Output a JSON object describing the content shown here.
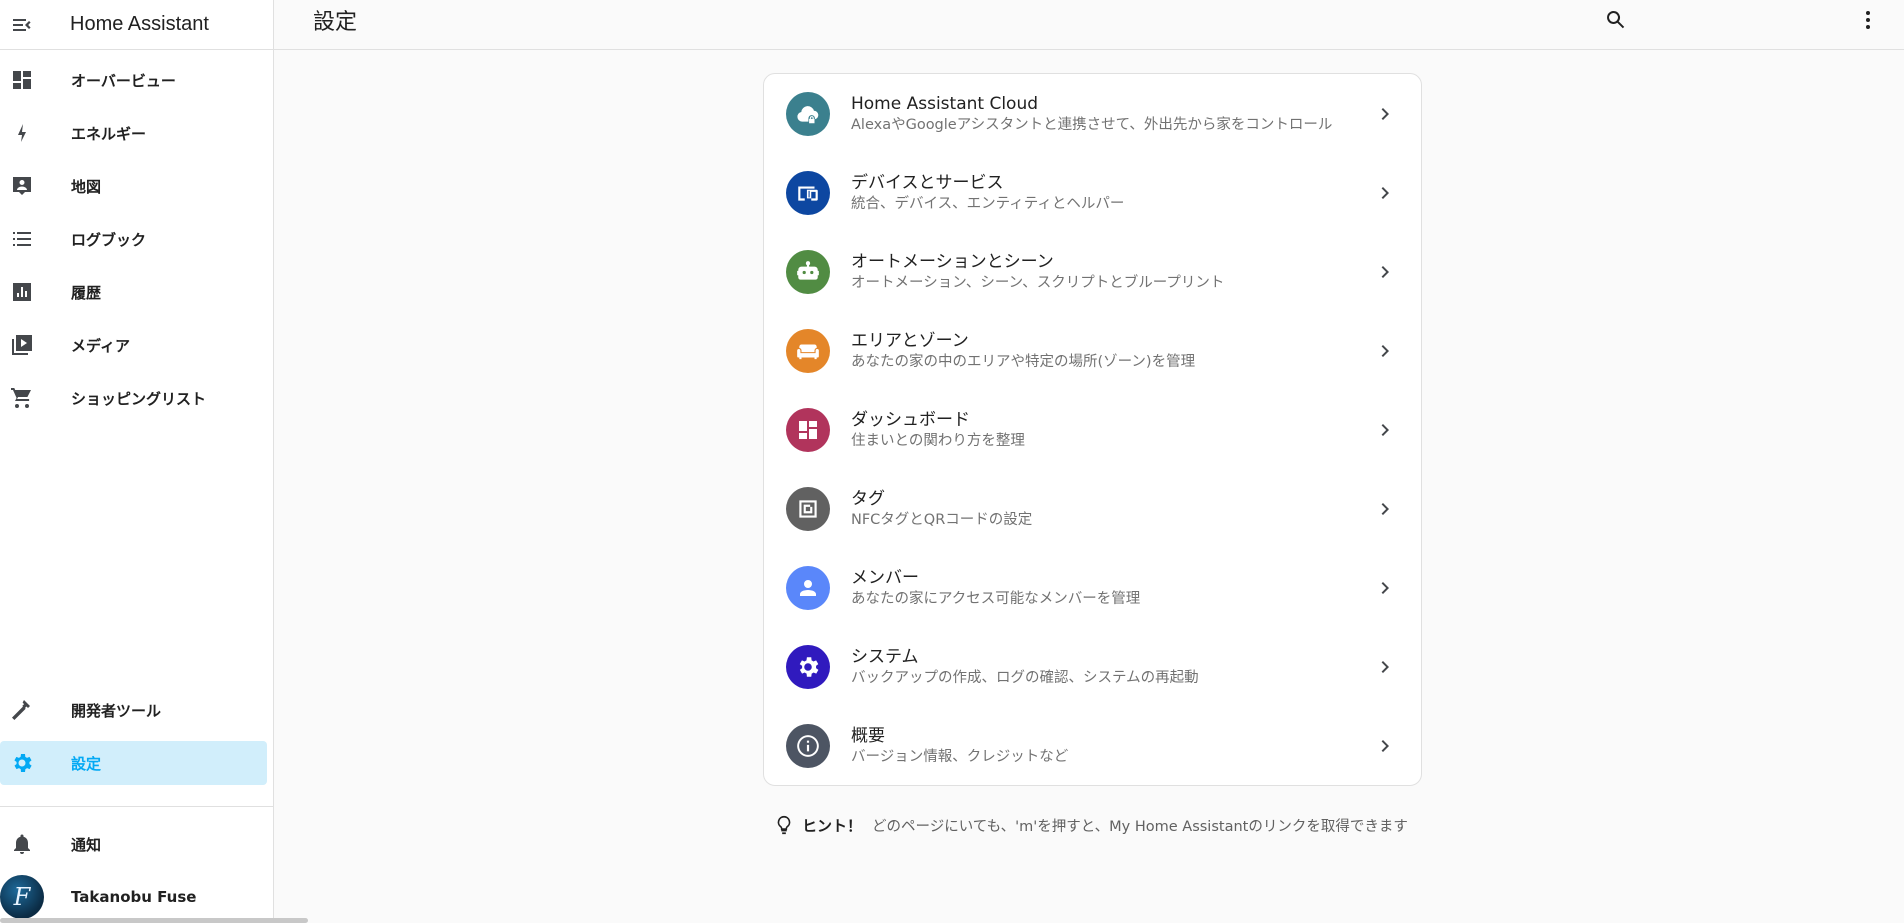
{
  "app": {
    "title": "Home Assistant"
  },
  "sidebar": {
    "items": [
      {
        "label": "オーバービュー",
        "icon": "dashboard-icon"
      },
      {
        "label": "エネルギー",
        "icon": "lightning-icon"
      },
      {
        "label": "地図",
        "icon": "map-person-icon"
      },
      {
        "label": "ログブック",
        "icon": "list-icon"
      },
      {
        "label": "履歴",
        "icon": "chart-icon"
      },
      {
        "label": "メディア",
        "icon": "media-play-icon"
      },
      {
        "label": "ショッピングリスト",
        "icon": "cart-icon"
      }
    ],
    "bottom_items": [
      {
        "label": "開発者ツール",
        "icon": "hammer-icon"
      },
      {
        "label": "設定",
        "icon": "gear-icon",
        "active": true
      }
    ],
    "notifications_label": "通知",
    "user_name": "Takanobu Fuse",
    "avatar_letter": "F"
  },
  "header": {
    "title": "設定"
  },
  "config_items": [
    {
      "title": "Home Assistant Cloud",
      "desc": "AlexaやGoogleアシスタントと連携させて、外出先から家をコントロール",
      "icon": "cloud-lock-icon",
      "color": "#3B808E"
    },
    {
      "title": "デバイスとサービス",
      "desc": "統合、デバイス、エンティティとヘルパー",
      "icon": "devices-icon",
      "color": "#0D47A1"
    },
    {
      "title": "オートメーションとシーン",
      "desc": "オートメーション、シーン、スクリプトとブループリント",
      "icon": "robot-icon",
      "color": "#518C43"
    },
    {
      "title": "エリアとゾーン",
      "desc": "あなたの家の中のエリアや特定の場所(ゾーン)を管理",
      "icon": "sofa-icon",
      "color": "#E48629"
    },
    {
      "title": "ダッシュボード",
      "desc": "住まいとの関わり方を整理",
      "icon": "dashboard-icon",
      "color": "#B1345C"
    },
    {
      "title": "タグ",
      "desc": "NFCタグとQRコードの設定",
      "icon": "nfc-icon",
      "color": "#616161"
    },
    {
      "title": "メンバー",
      "desc": "あなたの家にアクセス可能なメンバーを管理",
      "icon": "person-icon",
      "color": "#5A87FA"
    },
    {
      "title": "システム",
      "desc": "バックアップの作成、ログの確認、システムの再起動",
      "icon": "gear-icon",
      "color": "#301ABE"
    },
    {
      "title": "概要",
      "desc": "バージョン情報、クレジットなど",
      "icon": "info-icon",
      "color": "#4D5563"
    }
  ],
  "hint": {
    "label": "ヒント！",
    "text": "どのページにいても、'm'を押すと、My Home Assistantのリンクを取得できます"
  }
}
